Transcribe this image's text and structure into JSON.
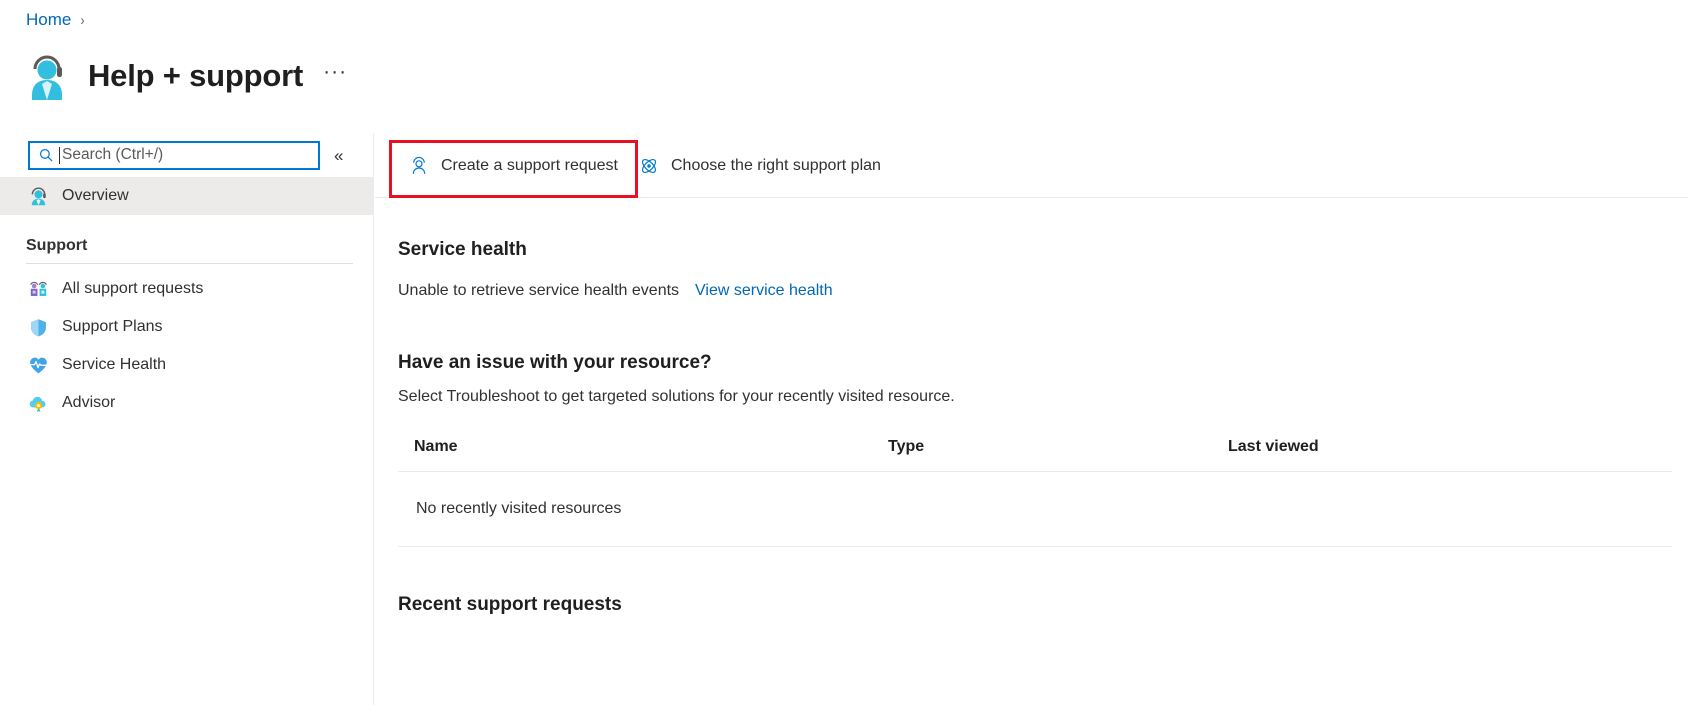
{
  "breadcrumb": {
    "home_label": "Home",
    "separator": "›"
  },
  "header": {
    "title": "Help + support",
    "icon": "support-agent-icon",
    "more_label": "···"
  },
  "sidebar": {
    "search": {
      "placeholder": "Search (Ctrl+/)",
      "value": "",
      "icon": "search-icon"
    },
    "collapse_icon": "«",
    "overview": {
      "label": "Overview",
      "icon": "support-agent-icon",
      "selected": true
    },
    "group_title": "Support",
    "items": [
      {
        "label": "All support requests",
        "icon": "people-group-icon"
      },
      {
        "label": "Support Plans",
        "icon": "shield-icon"
      },
      {
        "label": "Service Health",
        "icon": "heart-pulse-icon"
      },
      {
        "label": "Advisor",
        "icon": "cloud-advisor-icon"
      }
    ]
  },
  "command_bar": {
    "buttons": [
      {
        "label": "Create a support request",
        "icon": "person-add-icon",
        "highlighted": true
      },
      {
        "label": "Choose the right support plan",
        "icon": "atom-icon",
        "highlighted": false
      }
    ],
    "highlight_color": "#e81123"
  },
  "main": {
    "service_health": {
      "title": "Service health",
      "status_text": "Unable to retrieve service health events",
      "link_label": "View service health"
    },
    "resource_issue": {
      "title": "Have an issue with your resource?",
      "subtitle": "Select Troubleshoot to get targeted solutions for your recently visited resource."
    },
    "resource_table": {
      "columns": [
        "Name",
        "Type",
        "Last viewed"
      ],
      "empty_message": "No recently visited resources",
      "rows": []
    },
    "recent_requests": {
      "title": "Recent support requests"
    }
  },
  "colors": {
    "accent": "#0078d4",
    "link": "#0067b8",
    "highlight": "#e81123",
    "selected_bg": "#edebe9"
  }
}
